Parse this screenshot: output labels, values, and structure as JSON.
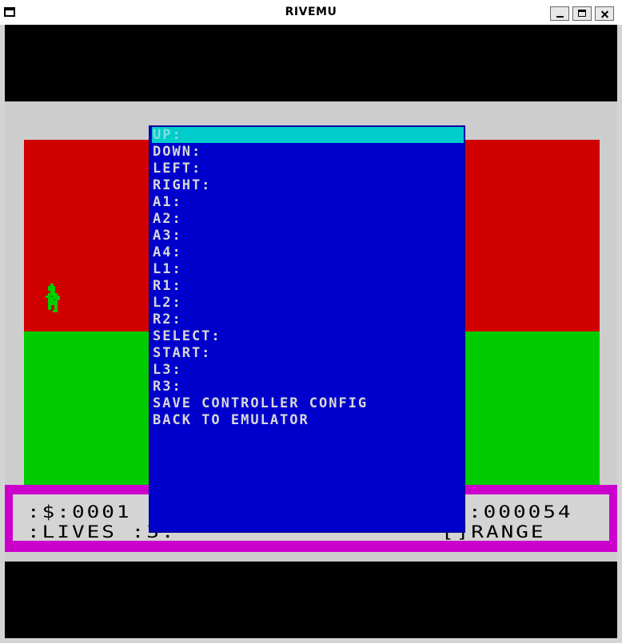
{
  "window": {
    "title": "RIVEMU"
  },
  "hud": {
    "line1_left": ":$:0001",
    "line2_left": ":LIVES :3:",
    "line1_right": ":000054",
    "line2_right": "[]RANGE"
  },
  "menu": {
    "items": [
      {
        "label": "UP:",
        "selected": true
      },
      {
        "label": "DOWN:"
      },
      {
        "label": "LEFT:"
      },
      {
        "label": "RIGHT:"
      },
      {
        "label": "A1:"
      },
      {
        "label": "A2:"
      },
      {
        "label": "A3:"
      },
      {
        "label": "A4:"
      },
      {
        "label": "L1:"
      },
      {
        "label": "R1:"
      },
      {
        "label": "L2:"
      },
      {
        "label": "R2:"
      },
      {
        "label": "SELECT:"
      },
      {
        "label": "START:"
      },
      {
        "label": "L3:"
      },
      {
        "label": "R3:"
      },
      {
        "label": "SAVE CONTROLLER CONFIG"
      },
      {
        "label": "BACK TO EMULATOR"
      }
    ]
  },
  "colors": {
    "menu_bg": "#0000cc",
    "menu_selected": "#00cccc",
    "sky_red": "#d00000",
    "ground_green": "#00cc00",
    "hud_border": "#cc00cc"
  }
}
